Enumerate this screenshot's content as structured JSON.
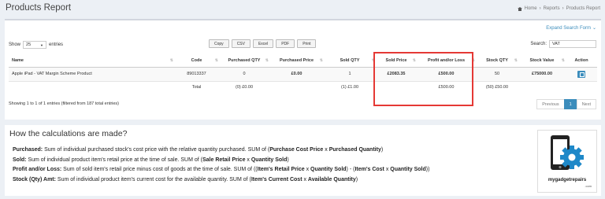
{
  "header": {
    "title": "Products Report",
    "breadcrumb": [
      "Home",
      "Reports",
      "Products Report"
    ]
  },
  "toolbar": {
    "expand_label": "Expand Search Form",
    "show_label": "Show",
    "page_length": "25",
    "entries_label": "entries",
    "export_buttons": [
      "Copy",
      "CSV",
      "Excel",
      "PDF",
      "Print"
    ],
    "search_label": "Search:",
    "search_value": "VAT"
  },
  "table": {
    "columns": [
      "Name",
      "Code",
      "Purchased QTY",
      "Purchased Price",
      "Sold QTY",
      "Sold Price",
      "Profit and/or Loss",
      "Stock QTY",
      "Stock Value",
      "Action"
    ],
    "rows": [
      {
        "name": "Apple iPad - VAT Margin Scheme Product",
        "code": "89013337",
        "purchased_qty": "0",
        "purchased_price": "£0.00",
        "sold_qty": "1",
        "sold_price": "£2083.35",
        "profit_loss": "£500.00",
        "stock_qty": "50",
        "stock_value": "£75000.00"
      }
    ],
    "totals": {
      "label": "Total",
      "purchased": "(0) £0.00",
      "sold": "(1) £1.00",
      "profit_loss": "£500.00",
      "stock": "(50) £50.00"
    }
  },
  "footer": {
    "info": "Showing 1 to 1 of 1 entries (filtered from 187 total entries)",
    "previous": "Previous",
    "current_page": "1",
    "next": "Next"
  },
  "calc": {
    "title": "How the calculations are made?",
    "lines": [
      {
        "term": "Purchased:",
        "text1": " Sum of individual purchased stock's cost price with the relative quantity purchased. SUM of (",
        "bold1": "Purchase Cost Price",
        "text2": " x ",
        "bold2": "Purchased Quantity",
        "text3": ")"
      },
      {
        "term": "Sold:",
        "text1": " Sum of individual product item's retail price at the time of sale. SUM of (",
        "bold1": "Sale Retail Price",
        "text2": " x ",
        "bold2": "Quantity Sold",
        "text3": ")"
      },
      {
        "term": "Profit and/or Loss:",
        "text1": " Sum of sold item's retail price minus cost of goods at the time of sale. SUM of ((",
        "bold1": "Item's Retail Price",
        "text2": " x ",
        "bold2": "Quantity Sold",
        "text3": ") - (",
        "bold3": "Item's Cost",
        "text4": " x ",
        "bold4": "Quantity Sold",
        "text5": "))"
      },
      {
        "term": "Stock (Qty) Amt:",
        "text1": " Sum of individual product item's current cost for the available quantity. SUM of (",
        "bold1": "Item's Current Cost",
        "text2": " x ",
        "bold2": "Available Quantity",
        "text3": ")"
      }
    ]
  },
  "logo": {
    "name": "mygadgetrepairs",
    "domain": ".com"
  },
  "colors": {
    "accent": "#3c8dbc",
    "highlight": "#e53935",
    "background": "#ecf0f5"
  }
}
